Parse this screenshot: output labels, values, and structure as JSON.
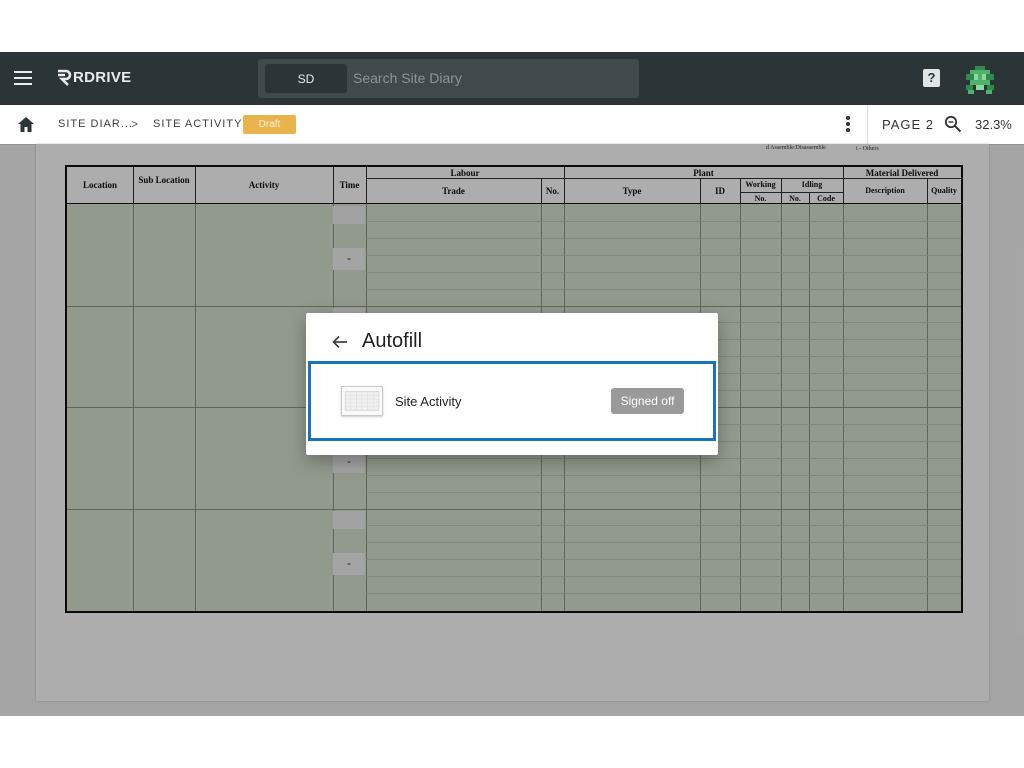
{
  "app": {
    "logo_text": "RDRIVE"
  },
  "search": {
    "scope_chip": "SD",
    "placeholder": "Search Site Diary"
  },
  "header": {
    "help_label": "?"
  },
  "breadcrumb": {
    "items": [
      {
        "label": "SITE DIAR..."
      },
      {
        "label": "SITE ACTIVITY"
      }
    ],
    "separator": ">",
    "status_badge": "Draft"
  },
  "viewer": {
    "page_label": "PAGE 2",
    "zoom": "32.3%"
  },
  "document": {
    "legend": [
      "d Assemble/Disassemble",
      "i - Others"
    ],
    "table_headers": {
      "location": "Location",
      "sub_location": "Sub Location",
      "activity": "Activity",
      "time": "Time",
      "labour": "Labour",
      "trade": "Trade",
      "no": "No.",
      "plant": "Plant",
      "type": "Type",
      "id": "ID",
      "working": "Working",
      "working_no": "No.",
      "idling": "Idling",
      "idling_no": "No.",
      "idling_code": "Code",
      "material_delivered": "Material Delivered",
      "description": "Description",
      "quality": "Quality"
    },
    "time_placeholders": [
      "-",
      "-",
      "-"
    ]
  },
  "modal": {
    "title": "Autofill",
    "items": [
      {
        "label": "Site Activity",
        "status": "Signed off"
      }
    ]
  },
  "colors": {
    "topbar": "#2b3436",
    "draft": "#e9b44c",
    "selection": "#1a73bf",
    "sheet_fill": "#d7e4d1"
  }
}
